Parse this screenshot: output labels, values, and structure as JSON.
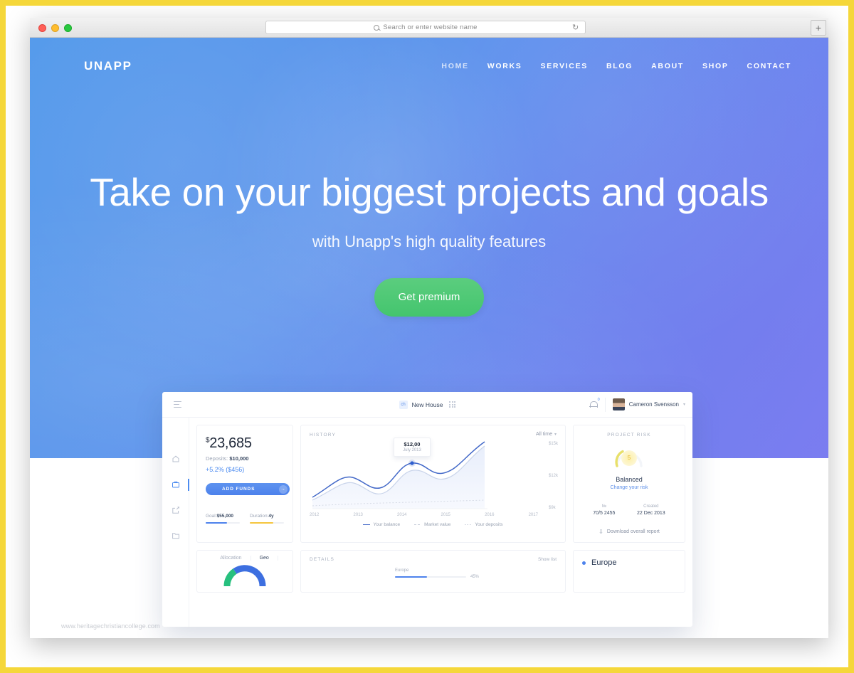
{
  "browser": {
    "omnibox_placeholder": "Search or enter website name",
    "reload_icon": "reload-icon",
    "newtab_label": "+",
    "traffic_lights": [
      "close",
      "minimize",
      "maximize"
    ]
  },
  "site": {
    "brand": "UNAPP",
    "nav": [
      {
        "label": "HOME",
        "active": true
      },
      {
        "label": "WORKS",
        "active": false
      },
      {
        "label": "SERVICES",
        "active": false
      },
      {
        "label": "BLOG",
        "active": false
      },
      {
        "label": "ABOUT",
        "active": false
      },
      {
        "label": "SHOP",
        "active": false
      },
      {
        "label": "CONTACT",
        "active": false
      }
    ],
    "hero": {
      "title": "Take on your biggest projects and goals",
      "subtitle": "with Unapp's high quality features",
      "cta_label": "Get premium",
      "cta_color": "#4ec87a",
      "bg_from": "#4f97ea",
      "bg_to": "#7b7ff2"
    },
    "watermark": "www.heritagechristiancollege.com"
  },
  "dashboard": {
    "topbar": {
      "menu_icon": "hamburger-icon",
      "project_badge": "ch",
      "project_name": "New House",
      "grid_icon": "apps-grid-icon",
      "bell_icon": "bell-icon",
      "bell_count": "0",
      "user_name": "Cameron Svensson",
      "caret": "▾"
    },
    "sidebar": [
      {
        "icon": "home-icon",
        "active": false
      },
      {
        "icon": "briefcase-icon",
        "active": true
      },
      {
        "icon": "export-icon",
        "active": false
      },
      {
        "icon": "folder-icon",
        "active": false
      }
    ],
    "balance": {
      "currency": "$",
      "amount": "23,685",
      "deposits_label": "Deposits:",
      "deposits_value": "$10,000",
      "gain": "+5.2% ($456)",
      "button_label": "ADD FUNDS",
      "button_arrow": "→",
      "metrics": [
        {
          "label": "Goal:",
          "value": "$55,000",
          "percent": 62,
          "color": "#4d82ec"
        },
        {
          "label": "Duration:",
          "value": "4y",
          "percent": 68,
          "color": "#f5c53d"
        }
      ]
    },
    "history": {
      "label": "HISTORY",
      "range": "All time",
      "tooltip_value": "$12,00",
      "tooltip_date": "July 2013",
      "download_label": "Download overall report"
    },
    "risk": {
      "label": "PROJECT RISK",
      "score": "5",
      "title": "Balanced",
      "link": "Change your risk",
      "meta": [
        {
          "label": "№",
          "value": "70/5 2455"
        },
        {
          "label": "Created",
          "value": "22 Dec 2013"
        }
      ],
      "download_label": "Download overall report",
      "download_icon": "download-icon"
    },
    "allocation": {
      "tabs": [
        {
          "label": "Allocation",
          "active": false
        },
        {
          "label": "Geo",
          "active": true
        }
      ]
    },
    "details": {
      "label": "DETAILS",
      "show_list": "Show list",
      "rows": [
        {
          "name": "Europe",
          "percent": 45,
          "percent_label": "45%"
        }
      ],
      "highlight": "Europe"
    }
  },
  "chart_data": {
    "type": "line",
    "title": "HISTORY",
    "xlabel": "",
    "ylabel": "",
    "x": [
      "2012",
      "2013",
      "2014",
      "2015",
      "2016",
      "2017"
    ],
    "categories": [
      "2012",
      "2013",
      "2014",
      "2015",
      "2016",
      "2017"
    ],
    "ytick_labels": [
      "$15k",
      "$12k",
      "$9k"
    ],
    "ylim": [
      6000,
      16000
    ],
    "grid": false,
    "legend_position": "bottom",
    "annotations": [
      {
        "label": "$12,00",
        "sublabel": "July 2013",
        "x": "2013",
        "y": 12000
      }
    ],
    "series": [
      {
        "name": "Your balance",
        "style": "solid",
        "color": "#4268c8",
        "values": [
          7200,
          9600,
          8700,
          12000,
          11200,
          15000
        ]
      },
      {
        "name": "Market value",
        "style": "dashed",
        "color": "#c7cdd9",
        "values": [
          6600,
          8600,
          7800,
          10400,
          10000,
          14000
        ]
      },
      {
        "name": "Your deposits",
        "style": "dotted",
        "color": "#c7cdd9",
        "values": [
          6400,
          6600,
          6700,
          6900,
          7000,
          7200
        ]
      }
    ]
  }
}
